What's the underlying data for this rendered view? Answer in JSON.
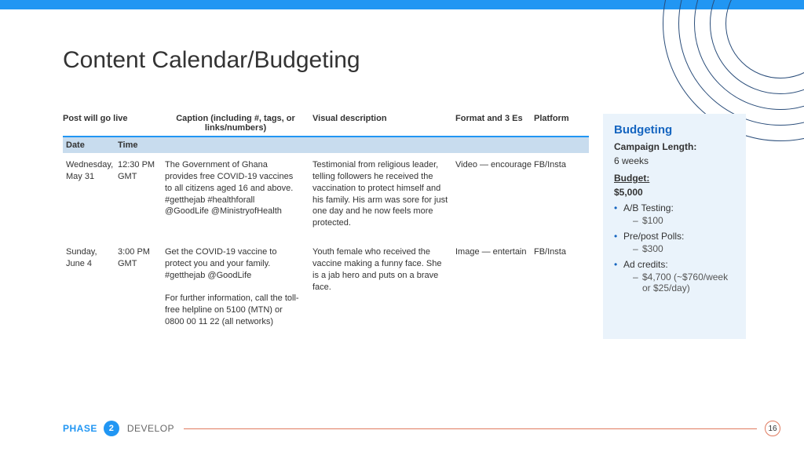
{
  "title": "Content Calendar/Budgeting",
  "table": {
    "headers": {
      "post": "Post will go live",
      "caption": "Caption (including #, tags, or links/numbers)",
      "visual": "Visual description",
      "format": "Format and 3 Es",
      "platform": "Platform",
      "date": "Date",
      "time": "Time"
    },
    "rows": [
      {
        "date": "Wednesday, May 31",
        "time": "12:30 PM GMT",
        "caption": "The Government of Ghana provides free COVID-19 vaccines to all citizens aged 16 and above. #getthejab #healthforall @GoodLife @MinistryofHealth",
        "visual": "Testimonial from religious leader, telling followers he received the vaccination to protect himself and his family. His arm was sore for just one day and he now feels more protected.",
        "format": "Video — encourage",
        "platform": "FB/Insta"
      },
      {
        "date": "Sunday, June 4",
        "time": "3:00 PM GMT",
        "caption": "Get the COVID-19 vaccine to protect you and your family. #getthejab @GoodLife\n\nFor further information, call the toll-free helpline on 5100 (MTN) or 0800 00 11 22 (all networks)",
        "visual": "Youth female who received the vaccine making a funny face. She is a jab hero and puts on a brave face.",
        "format": "Image — entertain",
        "platform": "FB/Insta"
      }
    ]
  },
  "side": {
    "title": "Budgeting",
    "length_label": "Campaign Length:",
    "length_value": "6 weeks",
    "budget_label": "Budget:",
    "budget_value": "$5,000",
    "items": [
      {
        "name": "A/B Testing:",
        "sub": "$100"
      },
      {
        "name": "Pre/post Polls:",
        "sub": "$300"
      },
      {
        "name": "Ad credits:",
        "sub": "$4,700 (~$760/week or $25/day)"
      }
    ]
  },
  "footer": {
    "phase_label": "PHASE",
    "phase_num": "2",
    "phase_name": "DEVELOP",
    "page": "16"
  }
}
